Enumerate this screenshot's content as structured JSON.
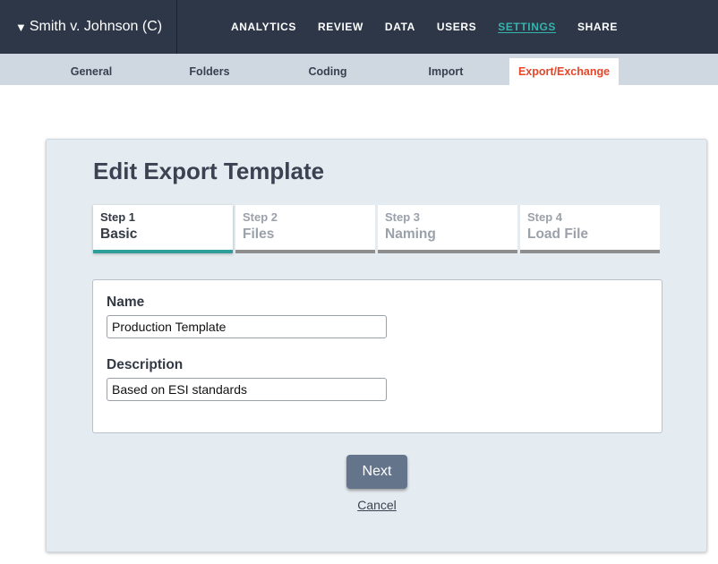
{
  "topbar": {
    "case_name": "Smith v. Johnson (C)",
    "case_caret": "▼",
    "nav": [
      {
        "label": "ANALYTICS"
      },
      {
        "label": "REVIEW"
      },
      {
        "label": "DATA"
      },
      {
        "label": "USERS"
      },
      {
        "label": "SETTINGS",
        "active": true
      },
      {
        "label": "SHARE"
      }
    ]
  },
  "subnav": {
    "tabs": [
      {
        "label": "General"
      },
      {
        "label": "Folders"
      },
      {
        "label": "Coding"
      },
      {
        "label": "Import"
      },
      {
        "label": "Export/Exchange",
        "active": true
      }
    ]
  },
  "panel": {
    "title": "Edit Export Template",
    "steps": [
      {
        "number": "Step 1",
        "name": "Basic",
        "active": true
      },
      {
        "number": "Step 2",
        "name": "Files"
      },
      {
        "number": "Step 3",
        "name": "Naming"
      },
      {
        "number": "Step 4",
        "name": "Load File"
      }
    ],
    "form": {
      "name_label": "Name",
      "name_value": "Production Template",
      "description_label": "Description",
      "description_value": "Based on ESI standards"
    },
    "next_label": "Next",
    "cancel_label": "Cancel"
  },
  "colors": {
    "topbar_bg": "#2d3748",
    "active_nav": "#38b2ac",
    "active_subtab": "#e8462a",
    "active_step_underline": "#2e9e9a",
    "next_button_bg": "#64748b"
  }
}
